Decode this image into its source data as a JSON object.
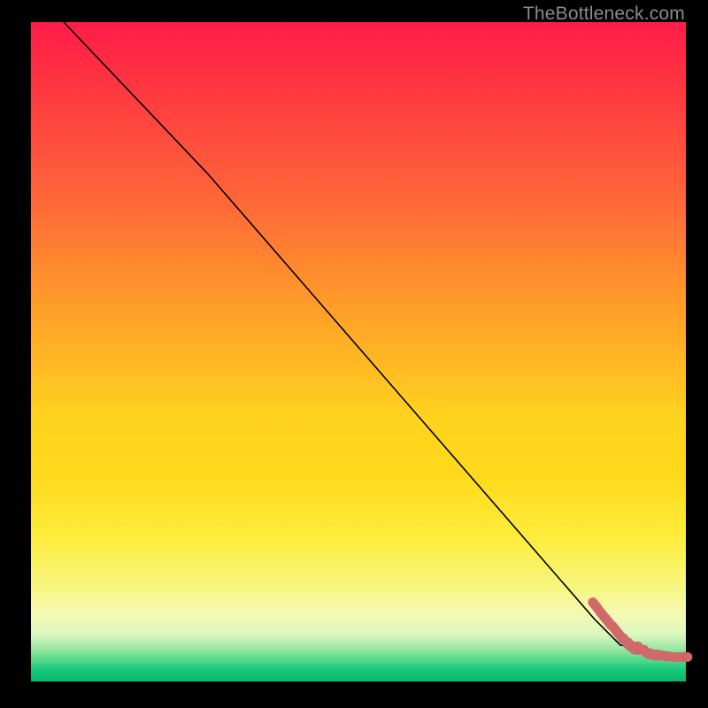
{
  "watermark": "TheBottleneck.com",
  "chart_data": {
    "type": "line",
    "title": "",
    "xlabel": "",
    "ylabel": "",
    "xlim": [
      0,
      1
    ],
    "ylim": [
      0,
      1
    ],
    "series": [
      {
        "name": "curve",
        "style": "solid-black",
        "x": [
          0.05,
          0.27,
          0.86,
          0.9,
          1.0
        ],
        "y": [
          1.0,
          0.77,
          0.095,
          0.055,
          0.04
        ]
      },
      {
        "name": "points",
        "style": "dots-pink",
        "x": [
          0.858,
          0.868,
          0.878,
          0.888,
          0.896,
          0.904,
          0.912,
          0.921,
          0.93,
          0.94,
          0.95,
          0.96,
          0.972,
          0.985,
          0.996
        ],
        "y": [
          0.12,
          0.107,
          0.095,
          0.084,
          0.074,
          0.066,
          0.059,
          0.053,
          0.048,
          0.044,
          0.041,
          0.039,
          0.038,
          0.037,
          0.037
        ]
      }
    ],
    "background_gradient": {
      "top": "#ff1c49",
      "mid": "#ffd31e",
      "bottom": "#06b86e"
    }
  }
}
